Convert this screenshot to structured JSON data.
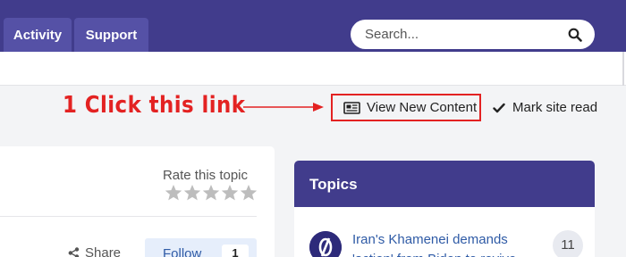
{
  "nav": {
    "tabs": [
      {
        "label": "Activity"
      },
      {
        "label": "Support"
      }
    ]
  },
  "search": {
    "placeholder": "Search...",
    "icon": "search-icon"
  },
  "annotation": {
    "text": "1 Click this link",
    "color": "#e32222"
  },
  "links": {
    "view_new_content": "View New Content",
    "mark_site_read": "Mark site read"
  },
  "topic_panel": {
    "rate_label": "Rate this topic",
    "rating_stars": 5,
    "rating_value": 0,
    "share_label": "Share",
    "follow_label": "Follow",
    "follow_count": "1"
  },
  "topics_widget": {
    "header": "Topics",
    "items": [
      {
        "title": "Iran's Khamenei demands 'action' from Biden to revive",
        "count": "11"
      }
    ]
  },
  "colors": {
    "header_bg": "#413c8c",
    "tab_bg": "#5551a6",
    "link": "#2f5ba6"
  }
}
